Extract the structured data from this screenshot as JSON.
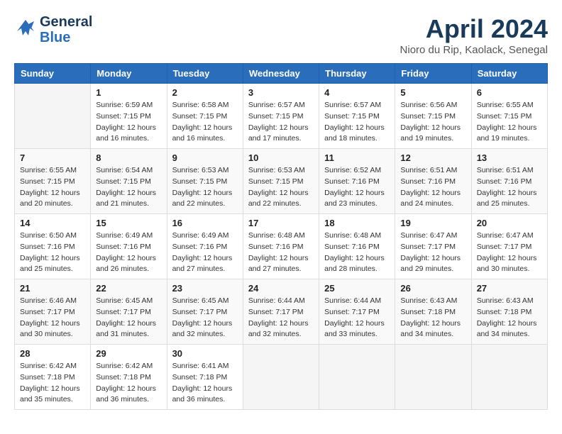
{
  "header": {
    "logo_line1": "General",
    "logo_line2": "Blue",
    "title": "April 2024",
    "subtitle": "Nioro du Rip, Kaolack, Senegal"
  },
  "calendar": {
    "days_of_week": [
      "Sunday",
      "Monday",
      "Tuesday",
      "Wednesday",
      "Thursday",
      "Friday",
      "Saturday"
    ],
    "weeks": [
      [
        {
          "day": "",
          "info": ""
        },
        {
          "day": "1",
          "info": "Sunrise: 6:59 AM\nSunset: 7:15 PM\nDaylight: 12 hours\nand 16 minutes."
        },
        {
          "day": "2",
          "info": "Sunrise: 6:58 AM\nSunset: 7:15 PM\nDaylight: 12 hours\nand 16 minutes."
        },
        {
          "day": "3",
          "info": "Sunrise: 6:57 AM\nSunset: 7:15 PM\nDaylight: 12 hours\nand 17 minutes."
        },
        {
          "day": "4",
          "info": "Sunrise: 6:57 AM\nSunset: 7:15 PM\nDaylight: 12 hours\nand 18 minutes."
        },
        {
          "day": "5",
          "info": "Sunrise: 6:56 AM\nSunset: 7:15 PM\nDaylight: 12 hours\nand 19 minutes."
        },
        {
          "day": "6",
          "info": "Sunrise: 6:55 AM\nSunset: 7:15 PM\nDaylight: 12 hours\nand 19 minutes."
        }
      ],
      [
        {
          "day": "7",
          "info": "Sunrise: 6:55 AM\nSunset: 7:15 PM\nDaylight: 12 hours\nand 20 minutes."
        },
        {
          "day": "8",
          "info": "Sunrise: 6:54 AM\nSunset: 7:15 PM\nDaylight: 12 hours\nand 21 minutes."
        },
        {
          "day": "9",
          "info": "Sunrise: 6:53 AM\nSunset: 7:15 PM\nDaylight: 12 hours\nand 22 minutes."
        },
        {
          "day": "10",
          "info": "Sunrise: 6:53 AM\nSunset: 7:15 PM\nDaylight: 12 hours\nand 22 minutes."
        },
        {
          "day": "11",
          "info": "Sunrise: 6:52 AM\nSunset: 7:16 PM\nDaylight: 12 hours\nand 23 minutes."
        },
        {
          "day": "12",
          "info": "Sunrise: 6:51 AM\nSunset: 7:16 PM\nDaylight: 12 hours\nand 24 minutes."
        },
        {
          "day": "13",
          "info": "Sunrise: 6:51 AM\nSunset: 7:16 PM\nDaylight: 12 hours\nand 25 minutes."
        }
      ],
      [
        {
          "day": "14",
          "info": "Sunrise: 6:50 AM\nSunset: 7:16 PM\nDaylight: 12 hours\nand 25 minutes."
        },
        {
          "day": "15",
          "info": "Sunrise: 6:49 AM\nSunset: 7:16 PM\nDaylight: 12 hours\nand 26 minutes."
        },
        {
          "day": "16",
          "info": "Sunrise: 6:49 AM\nSunset: 7:16 PM\nDaylight: 12 hours\nand 27 minutes."
        },
        {
          "day": "17",
          "info": "Sunrise: 6:48 AM\nSunset: 7:16 PM\nDaylight: 12 hours\nand 27 minutes."
        },
        {
          "day": "18",
          "info": "Sunrise: 6:48 AM\nSunset: 7:16 PM\nDaylight: 12 hours\nand 28 minutes."
        },
        {
          "day": "19",
          "info": "Sunrise: 6:47 AM\nSunset: 7:17 PM\nDaylight: 12 hours\nand 29 minutes."
        },
        {
          "day": "20",
          "info": "Sunrise: 6:47 AM\nSunset: 7:17 PM\nDaylight: 12 hours\nand 30 minutes."
        }
      ],
      [
        {
          "day": "21",
          "info": "Sunrise: 6:46 AM\nSunset: 7:17 PM\nDaylight: 12 hours\nand 30 minutes."
        },
        {
          "day": "22",
          "info": "Sunrise: 6:45 AM\nSunset: 7:17 PM\nDaylight: 12 hours\nand 31 minutes."
        },
        {
          "day": "23",
          "info": "Sunrise: 6:45 AM\nSunset: 7:17 PM\nDaylight: 12 hours\nand 32 minutes."
        },
        {
          "day": "24",
          "info": "Sunrise: 6:44 AM\nSunset: 7:17 PM\nDaylight: 12 hours\nand 32 minutes."
        },
        {
          "day": "25",
          "info": "Sunrise: 6:44 AM\nSunset: 7:17 PM\nDaylight: 12 hours\nand 33 minutes."
        },
        {
          "day": "26",
          "info": "Sunrise: 6:43 AM\nSunset: 7:18 PM\nDaylight: 12 hours\nand 34 minutes."
        },
        {
          "day": "27",
          "info": "Sunrise: 6:43 AM\nSunset: 7:18 PM\nDaylight: 12 hours\nand 34 minutes."
        }
      ],
      [
        {
          "day": "28",
          "info": "Sunrise: 6:42 AM\nSunset: 7:18 PM\nDaylight: 12 hours\nand 35 minutes."
        },
        {
          "day": "29",
          "info": "Sunrise: 6:42 AM\nSunset: 7:18 PM\nDaylight: 12 hours\nand 36 minutes."
        },
        {
          "day": "30",
          "info": "Sunrise: 6:41 AM\nSunset: 7:18 PM\nDaylight: 12 hours\nand 36 minutes."
        },
        {
          "day": "",
          "info": ""
        },
        {
          "day": "",
          "info": ""
        },
        {
          "day": "",
          "info": ""
        },
        {
          "day": "",
          "info": ""
        }
      ]
    ]
  }
}
